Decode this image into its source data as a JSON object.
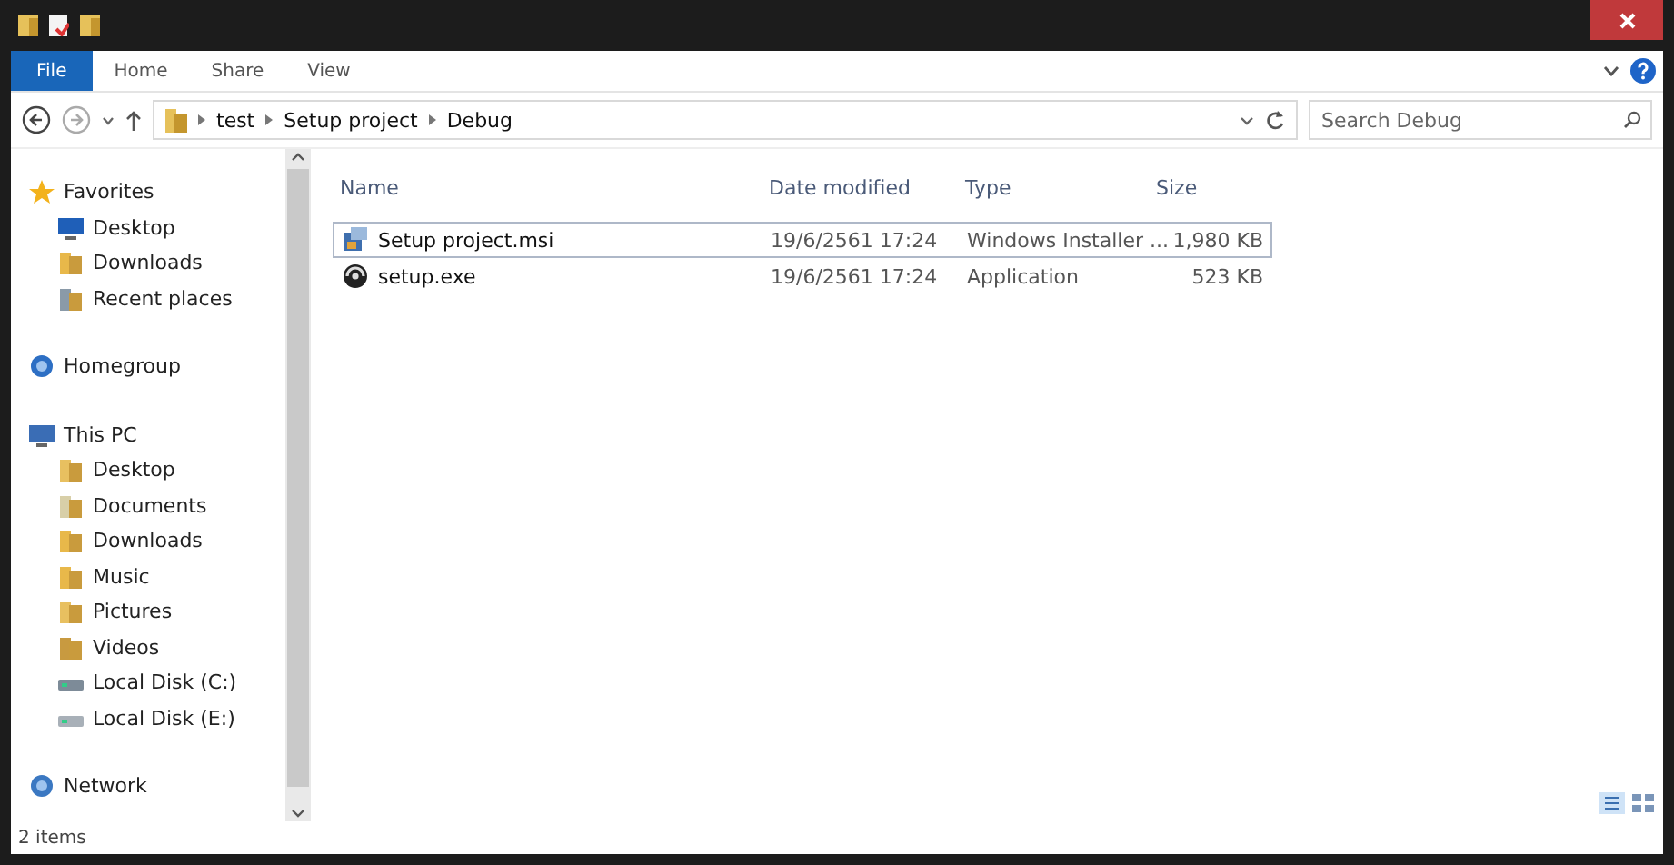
{
  "ribbon": {
    "tabs": [
      {
        "label": "File",
        "selected": true
      },
      {
        "label": "Home",
        "selected": false
      },
      {
        "label": "Share",
        "selected": false
      },
      {
        "label": "View",
        "selected": false
      }
    ]
  },
  "address": {
    "path": [
      "test",
      "Setup project",
      "Debug"
    ]
  },
  "search": {
    "placeholder": "Search Debug"
  },
  "sidebar": {
    "items": [
      {
        "label": "Favorites",
        "kind": "star",
        "children": [
          {
            "label": "Desktop",
            "kind": "desktop"
          },
          {
            "label": "Downloads",
            "kind": "downloads"
          },
          {
            "label": "Recent places",
            "kind": "recent"
          }
        ]
      },
      {
        "label": "Homegroup",
        "kind": "homegroup"
      },
      {
        "label": "This PC",
        "kind": "pc",
        "children": [
          {
            "label": "Desktop",
            "kind": "folder"
          },
          {
            "label": "Documents",
            "kind": "documents"
          },
          {
            "label": "Downloads",
            "kind": "downloads"
          },
          {
            "label": "Music",
            "kind": "music"
          },
          {
            "label": "Pictures",
            "kind": "pictures"
          },
          {
            "label": "Videos",
            "kind": "videos"
          },
          {
            "label": "Local Disk (C:)",
            "kind": "disk"
          },
          {
            "label": "Local Disk (E:)",
            "kind": "drive"
          }
        ]
      },
      {
        "label": "Network",
        "kind": "network"
      }
    ]
  },
  "table": {
    "columns": [
      "Name",
      "Date modified",
      "Type",
      "Size"
    ],
    "rows": [
      {
        "kind": "msi",
        "selected": true,
        "cells": [
          "Setup project.msi",
          "19/6/2561 17:24",
          "Windows Installer ...",
          "1,980 KB"
        ]
      },
      {
        "kind": "exe",
        "selected": false,
        "cells": [
          "setup.exe",
          "19/6/2561 17:24",
          "Application",
          "523 KB"
        ]
      }
    ]
  },
  "status_bar": {
    "text": "2 items"
  }
}
